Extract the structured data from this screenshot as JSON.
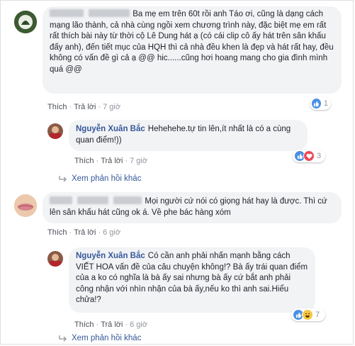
{
  "comments": [
    {
      "text": "Ba mẹ em trên 60t rồi anh Táo ơi, cũng là dạng cách mạng lão thành, cả nhà cùng ngồi xem chương trình này, đặc biệt mẹ em rất rất thích bài này từ thời cộ Lê Dung hát ạ (có cái clip cô ấy hát trên sân khấu đấy anh), đến tiết mục của HQH thì cả nhà đều khen là đẹp và hát rất hay, đều không có vấn đề gì cả ạ @@ hic......cũng hơi hoang mang cho gia đình mình quá @@",
      "like_label": "Thích",
      "reply_label": "Trả lời",
      "time": "7 giờ",
      "reaction_count": "1"
    },
    {
      "author": "Nguyễn Xuân Bắc",
      "text": "Hehehehe.tự tin lên,ít nhất là có a cùng quan điểm!))",
      "like_label": "Thích",
      "reply_label": "Trả lời",
      "time": "7 giờ",
      "reaction_count": "3"
    },
    {
      "text": "Mọi người cứ nói có giọng hát hay là được. Thì cứ lên sân khấu hát cũng ok á. Về phe bác hàng xóm",
      "like_label": "Thích",
      "reply_label": "Trả lời",
      "time": "6 giờ"
    },
    {
      "author": "Nguyễn Xuân Bắc",
      "text": "Có cần anh phải nhấn mạnh bằng cách VIẾT HOA vấn đề của câu chuyện không!? Bà ấy trái quan điểm của a ko có nghĩa là bà ấy sai nhưng bà ấy cứ bắt anh phải công nhận với nhìn nhận của bà ấy,nếu ko thì anh sai.Hiểu chửa!?",
      "like_label": "Thích",
      "reply_label": "Trả lời",
      "time": "6 giờ",
      "reaction_count": "7"
    }
  ],
  "more_replies_label": "Xem phản hồi khác",
  "colors": {
    "link": "#365899",
    "bubble": "#f2f3f5",
    "meta": "#90949c",
    "like": "#4a90e2",
    "love": "#ed4956",
    "haha": "#f7c744"
  }
}
